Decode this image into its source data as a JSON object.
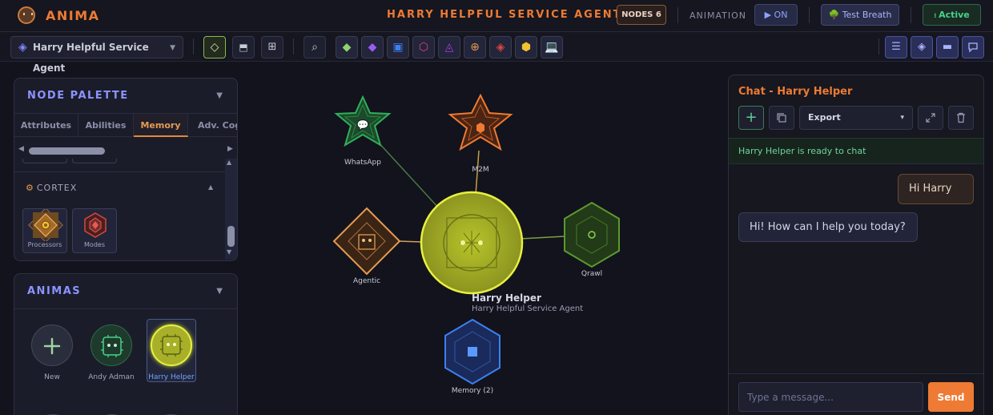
{
  "app": {
    "name": "ANIMA",
    "agent_title": "HARRY HELPFUL SERVICE AGENT",
    "nodes_badge": "NODES 6"
  },
  "header": {
    "animation_label": "ANIMATION",
    "on_button": "▶ ON",
    "breath_button": "🌳 Test Breath",
    "active_button": "Active"
  },
  "toolbar": {
    "agent_select": "Harry Helpful Service Agent",
    "tools": [
      "select",
      "layout",
      "grid",
      "search"
    ],
    "node_tools": [
      "green-diamond",
      "purple-diamond",
      "blue-square",
      "pink-hexagon",
      "purple-triangle",
      "orange-gear",
      "red-diamond",
      "yellow-hexagon",
      "laptop"
    ],
    "right_tools": [
      "list",
      "layers",
      "panel",
      "chat"
    ]
  },
  "palette": {
    "title": "NODE PALETTE",
    "tabs": [
      "Attributes",
      "Abilities",
      "Memory",
      "Adv. Cog"
    ],
    "active_tab": "Memory",
    "section": "CORTEX",
    "tiles": [
      {
        "label": "Processors",
        "color": "#e49a53"
      },
      {
        "label": "Modes",
        "color": "#d04b3a"
      }
    ]
  },
  "animas": {
    "title": "ANIMAS",
    "items": [
      {
        "label": "New"
      },
      {
        "label": "Andy Adman"
      },
      {
        "label": "Harry Helper"
      }
    ]
  },
  "canvas": {
    "nodes": [
      {
        "label": "WhatsApp"
      },
      {
        "label": "M2M"
      },
      {
        "label": "Agentic"
      },
      {
        "label": "Qrawl"
      },
      {
        "label": "Memory (2)"
      }
    ],
    "center_name": "Harry Helper",
    "center_sub": "Harry Helpful Service Agent"
  },
  "chat": {
    "title": "Chat - Harry Helper",
    "export_label": "Export",
    "status": "Harry Helper is ready to chat",
    "messages": [
      {
        "role": "user",
        "text": "Hi Harry"
      },
      {
        "role": "bot",
        "text": "Hi! How can I help you today?"
      }
    ],
    "input_placeholder": "Type a message...",
    "send_label": "Send"
  },
  "colors": {
    "brand": "#ee7a33",
    "accent": "#8c93ff",
    "active_green": "#46d38a",
    "center_node": "#c8d62a"
  }
}
